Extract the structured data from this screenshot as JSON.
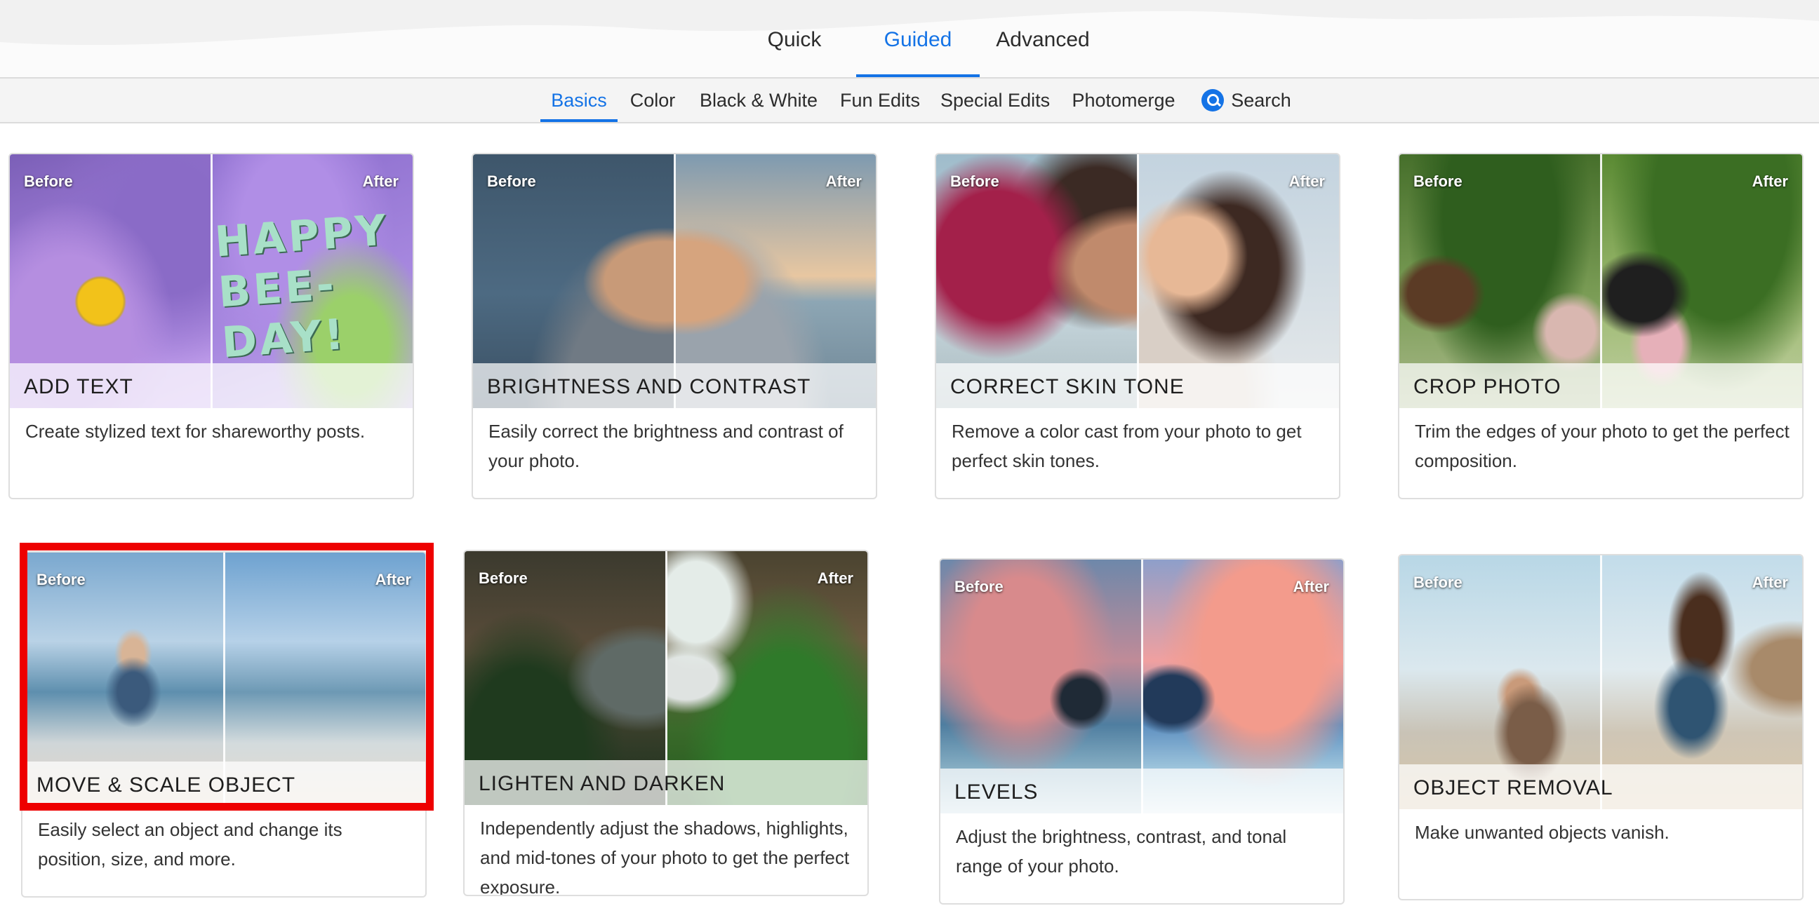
{
  "modes": [
    {
      "label": "Quick",
      "active": false
    },
    {
      "label": "Guided",
      "active": true
    },
    {
      "label": "Advanced",
      "active": false
    }
  ],
  "categories": [
    {
      "label": "Basics",
      "active": true
    },
    {
      "label": "Color",
      "active": false
    },
    {
      "label": "Black & White",
      "active": false
    },
    {
      "label": "Fun Edits",
      "active": false
    },
    {
      "label": "Special Edits",
      "active": false
    },
    {
      "label": "Photomerge",
      "active": false
    }
  ],
  "search": {
    "label": "Search",
    "icon": "search-icon"
  },
  "before_label": "Before",
  "after_label": "After",
  "cards": [
    {
      "title": "ADD TEXT",
      "description": "Create stylized text for shareworthy posts.",
      "overlay_text": "HAPPY BEE-DAY!"
    },
    {
      "title": "BRIGHTNESS AND CONTRAST",
      "description": "Easily correct the brightness and contrast of your photo."
    },
    {
      "title": "CORRECT SKIN TONE",
      "description": "Remove a color cast from your photo to get perfect skin tones."
    },
    {
      "title": "CROP PHOTO",
      "description": "Trim the edges of your photo to get the perfect composition."
    },
    {
      "title": "MOVE & SCALE OBJECT",
      "description": "Easily select an object and change its position, size, and more.",
      "highlighted": true
    },
    {
      "title": "LIGHTEN AND DARKEN",
      "description": "Independently adjust the shadows, highlights, and mid-tones of your photo to get the perfect exposure."
    },
    {
      "title": "LEVELS",
      "description": "Adjust the brightness, contrast, and tonal range of your photo."
    },
    {
      "title": "OBJECT REMOVAL",
      "description": "Make unwanted objects vanish."
    }
  ],
  "colors": {
    "accent": "#1473e6",
    "highlight": "#ee0000"
  }
}
